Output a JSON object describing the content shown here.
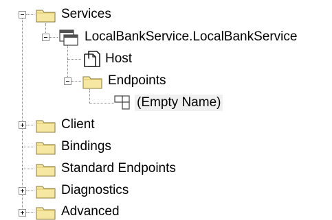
{
  "tree": {
    "services": "Services",
    "service_node": "LocalBankService.LocalBankService",
    "host": "Host",
    "endpoints": "Endpoints",
    "empty_name": "(Empty Name)",
    "client": "Client",
    "bindings": "Bindings",
    "standard_endpoints": "Standard Endpoints",
    "diagnostics": "Diagnostics",
    "advanced": "Advanced"
  },
  "colors": {
    "folder_fill": "#f6e7a3",
    "folder_stroke": "#8a7a3a",
    "connector": "#808080",
    "selection": "#f0f0f0"
  }
}
